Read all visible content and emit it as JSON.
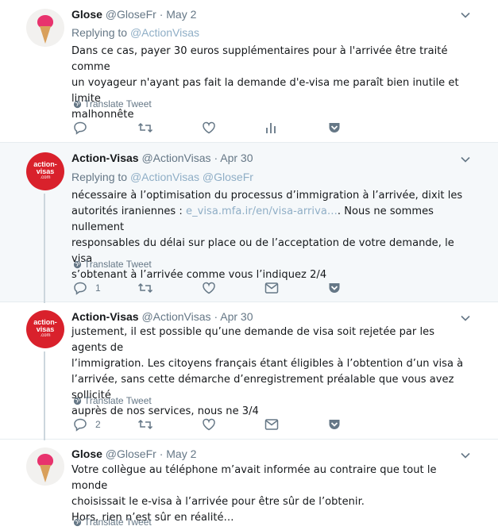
{
  "colors": {
    "accent": "#1da1f2",
    "muted": "#657786",
    "link": "#8faec6",
    "highlight": "#f5f8fa",
    "brand_red": "#d9212c"
  },
  "tweets": [
    {
      "name": "Glose",
      "handle": "@GloseFr",
      "dot": "·",
      "date": "May 2",
      "reply_prefix": "Replying to",
      "reply_mentions": "@ActionVisas",
      "text_lines": [
        "Dans ce cas, payer 30 euros supplémentaires pour à l'arrivée être traité comme",
        "un voyageur n'ayant pas fait la demande d'e-visa me paraît bien inutile et limite",
        "malhonnête"
      ],
      "translate": "Translate Tweet",
      "avatar": "glose-ice-cream-avatar",
      "reply_count": "",
      "icons": [
        "reply-icon",
        "retweet-icon",
        "like-icon",
        "analytics-icon",
        "pocket-icon"
      ]
    },
    {
      "name": "Action-Visas",
      "handle": "@ActionVisas",
      "dot": "·",
      "date": "Apr 30",
      "reply_prefix": "Replying to",
      "reply_mentions": "@ActionVisas @GloseFr",
      "text_lines": [
        "nécessaire à l’optimisation du processus d’immigration à l’arrivée, dixit les",
        "responsables du délai sur place ou de l’acceptation de votre demande, le visa",
        "s’obtenant à l’arrivée comme vous l’indiquez 2/4"
      ],
      "text_line2_prefix": "autorités iraniennes : ",
      "text_line2_link": "e_visa.mfa.ir/en/visa-arriva…",
      "text_line2_suffix": ". Nous ne sommes nullement",
      "translate": "Translate Tweet",
      "avatar_text": [
        "action-",
        "visas",
        ".com"
      ],
      "reply_count": "1",
      "icons": [
        "reply-icon",
        "retweet-icon",
        "like-icon",
        "mail-icon",
        "pocket-icon"
      ]
    },
    {
      "name": "Action-Visas",
      "handle": "@ActionVisas",
      "dot": "·",
      "date": "Apr 30",
      "text_lines": [
        "justement, il est possible qu’une demande de visa soit rejetée par les agents de",
        "l’immigration. Les citoyens français étant éligibles à l’obtention d’un visa à",
        "l’arrivée, sans cette démarche d’enregistrement préalable que vous avez sollicité",
        "auprès de nos services, nous ne 3/4"
      ],
      "translate": "Translate Tweet",
      "avatar_text": [
        "action-",
        "visas",
        ".com"
      ],
      "reply_count": "2",
      "icons": [
        "reply-icon",
        "retweet-icon",
        "like-icon",
        "mail-icon",
        "pocket-icon"
      ]
    },
    {
      "name": "Glose",
      "handle": "@GloseFr",
      "dot": "·",
      "date": "May 2",
      "text_lines": [
        "Votre collègue au téléphone m’avait informée au contraire que tout le monde",
        "choisissait le e-visa à l’arrivée pour être sûr de l’obtenir.",
        "Hors, rien n’est sûr en réalité…"
      ],
      "translate": "Translate Tweet"
    }
  ]
}
